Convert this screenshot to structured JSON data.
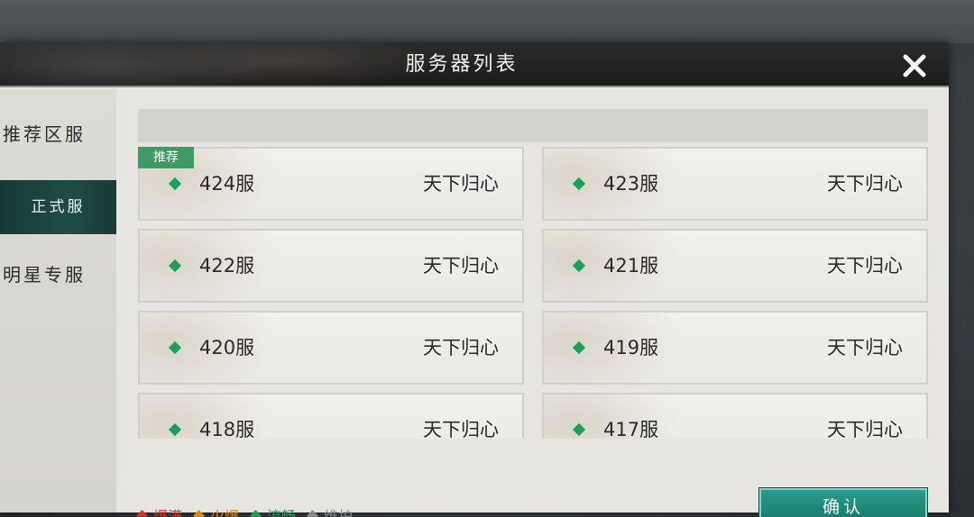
{
  "title": "服务器列表",
  "sidebar": {
    "items": [
      {
        "label": "推荐区服"
      },
      {
        "label": "正式服",
        "active": true
      },
      {
        "label": "明星专服"
      }
    ]
  },
  "servers": [
    {
      "name": "424服",
      "label": "天下归心",
      "status": "流畅",
      "badge": "推荐"
    },
    {
      "name": "423服",
      "label": "天下归心",
      "status": "流畅"
    },
    {
      "name": "422服",
      "label": "天下归心",
      "status": "流畅"
    },
    {
      "name": "421服",
      "label": "天下归心",
      "status": "流畅"
    },
    {
      "name": "420服",
      "label": "天下归心",
      "status": "流畅"
    },
    {
      "name": "419服",
      "label": "天下归心",
      "status": "流畅"
    },
    {
      "name": "418服",
      "label": "天下归心",
      "status": "流畅"
    },
    {
      "name": "417服",
      "label": "天下归心",
      "status": "流畅"
    }
  ],
  "legend": [
    {
      "label": "爆满",
      "color": "#d0342c"
    },
    {
      "label": "火爆",
      "color": "#d98a1f"
    },
    {
      "label": "流畅",
      "color": "#19a05a"
    },
    {
      "label": "维护",
      "color": "#8a8a8a"
    }
  ],
  "confirm_label": "确认",
  "colors": {
    "accent": "#1f8a7c",
    "active_tab": "#173a36",
    "status_smooth": "#19a05a"
  }
}
